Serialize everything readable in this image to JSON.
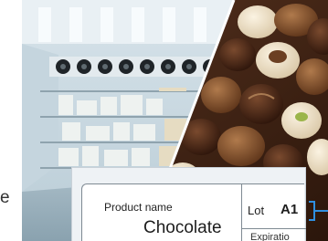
{
  "side_text": "e",
  "label": {
    "product_name_caption": "Product name",
    "product_name_value": "Chocolate",
    "lot_caption": "Lot",
    "lot_value": "A1",
    "expiration_caption": "Expiratio"
  },
  "colors": {
    "accent": "#2f8fe0",
    "label_border": "#7f8a93",
    "label_background": "#ffffff"
  }
}
